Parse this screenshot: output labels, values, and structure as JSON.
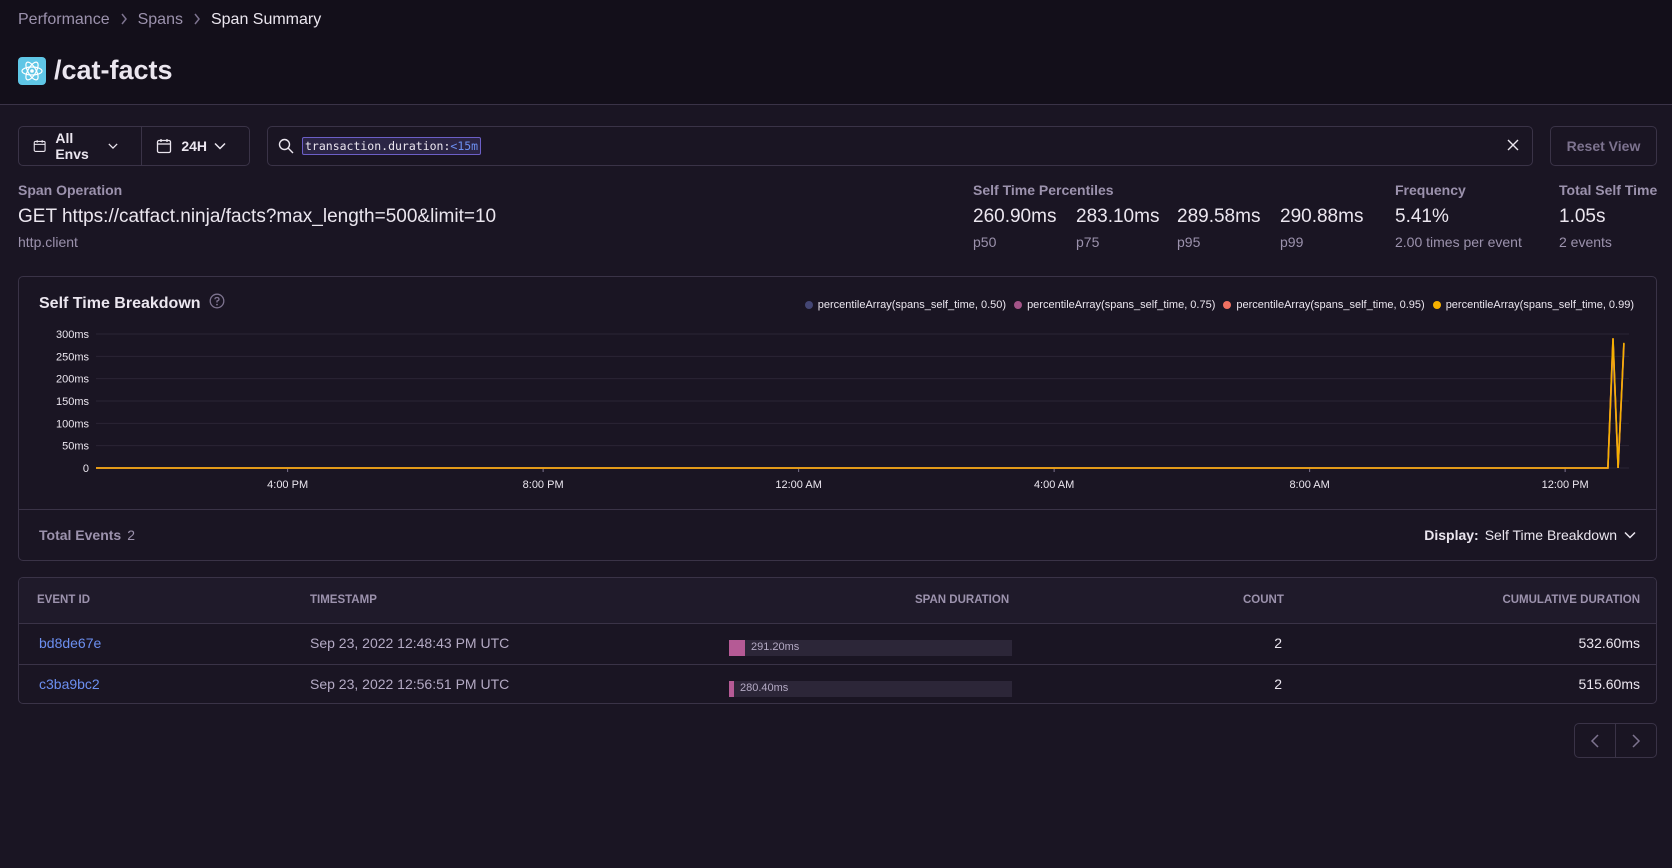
{
  "breadcrumbs": {
    "first": "Performance",
    "second": "Spans",
    "current": "Span Summary"
  },
  "page_title": "/cat-facts",
  "filters": {
    "env_label": "All Envs",
    "period_label": "24H"
  },
  "search": {
    "key": "transaction.duration:",
    "value": "<15m"
  },
  "reset_label": "Reset View",
  "span_operation": {
    "label": "Span Operation",
    "description": "GET https://catfact.ninja/facts?max_length=500&limit=10",
    "op": "http.client"
  },
  "percentiles": {
    "label": "Self Time Percentiles",
    "items": [
      {
        "value": "260.90ms",
        "name": "p50"
      },
      {
        "value": "283.10ms",
        "name": "p75"
      },
      {
        "value": "289.58ms",
        "name": "p95"
      },
      {
        "value": "290.88ms",
        "name": "p99"
      }
    ]
  },
  "frequency": {
    "label": "Frequency",
    "value": "5.41%",
    "sub": "2.00 times per event"
  },
  "total_self_time": {
    "label": "Total Self Time",
    "value": "1.05s",
    "sub": "2 events"
  },
  "chart_panel": {
    "title": "Self Time Breakdown",
    "total_events_label": "Total Events",
    "total_events_value": "2",
    "display_label": "Display:",
    "display_value": "Self Time Breakdown"
  },
  "chart_data": {
    "type": "line",
    "title": "Self Time Breakdown",
    "y_ticks": [
      "0",
      "50ms",
      "100ms",
      "150ms",
      "200ms",
      "250ms",
      "300ms"
    ],
    "ylim": [
      0,
      300
    ],
    "x_ticks": [
      "4:00 PM",
      "8:00 PM",
      "12:00 AM",
      "4:00 AM",
      "8:00 AM",
      "12:00 PM"
    ],
    "x_range_hours": [
      0,
      24
    ],
    "x_tick_hours": [
      3,
      7,
      11,
      15,
      19,
      23
    ],
    "legend_position": "top-right",
    "grid": true,
    "series": [
      {
        "name": "percentileArray(spans_self_time, 0.50)",
        "color": "#444674",
        "points": [
          [
            0,
            0
          ],
          [
            23.67,
            0
          ],
          [
            23.75,
            260.9
          ],
          [
            23.83,
            0
          ],
          [
            23.92,
            270.0
          ]
        ]
      },
      {
        "name": "percentileArray(spans_self_time, 0.75)",
        "color": "#a35488",
        "points": [
          [
            0,
            0
          ],
          [
            23.67,
            0
          ],
          [
            23.75,
            283.1
          ],
          [
            23.83,
            0
          ],
          [
            23.92,
            274.0
          ]
        ]
      },
      {
        "name": "percentileArray(spans_self_time, 0.95)",
        "color": "#ef7061",
        "points": [
          [
            0,
            0
          ],
          [
            23.67,
            0
          ],
          [
            23.75,
            289.58
          ],
          [
            23.83,
            0
          ],
          [
            23.92,
            278.0
          ]
        ]
      },
      {
        "name": "percentileArray(spans_self_time, 0.99)",
        "color": "#f5b000",
        "points": [
          [
            0,
            0
          ],
          [
            23.67,
            0
          ],
          [
            23.75,
            290.88
          ],
          [
            23.83,
            0
          ],
          [
            23.92,
            280.4
          ]
        ]
      }
    ]
  },
  "table": {
    "headers": {
      "event_id": "EVENT ID",
      "timestamp": "TIMESTAMP",
      "span_duration": "SPAN DURATION",
      "count": "COUNT",
      "cumulative": "CUMULATIVE DURATION"
    },
    "rows": [
      {
        "event_id": "bd8de67e",
        "timestamp": "Sep 23, 2022 12:48:43 PM UTC",
        "span_duration": "291.20ms",
        "duration_fraction": 0.055,
        "count": "2",
        "cumulative": "532.60ms"
      },
      {
        "event_id": "c3ba9bc2",
        "timestamp": "Sep 23, 2022 12:56:51 PM UTC",
        "span_duration": "280.40ms",
        "duration_fraction": 0.016,
        "count": "2",
        "cumulative": "515.60ms"
      }
    ]
  },
  "colors": {
    "background": "#1a1523",
    "header_bg": "#130f1a",
    "border": "#3a3347",
    "link": "#6c8ff0",
    "muted": "#9c92ad"
  }
}
